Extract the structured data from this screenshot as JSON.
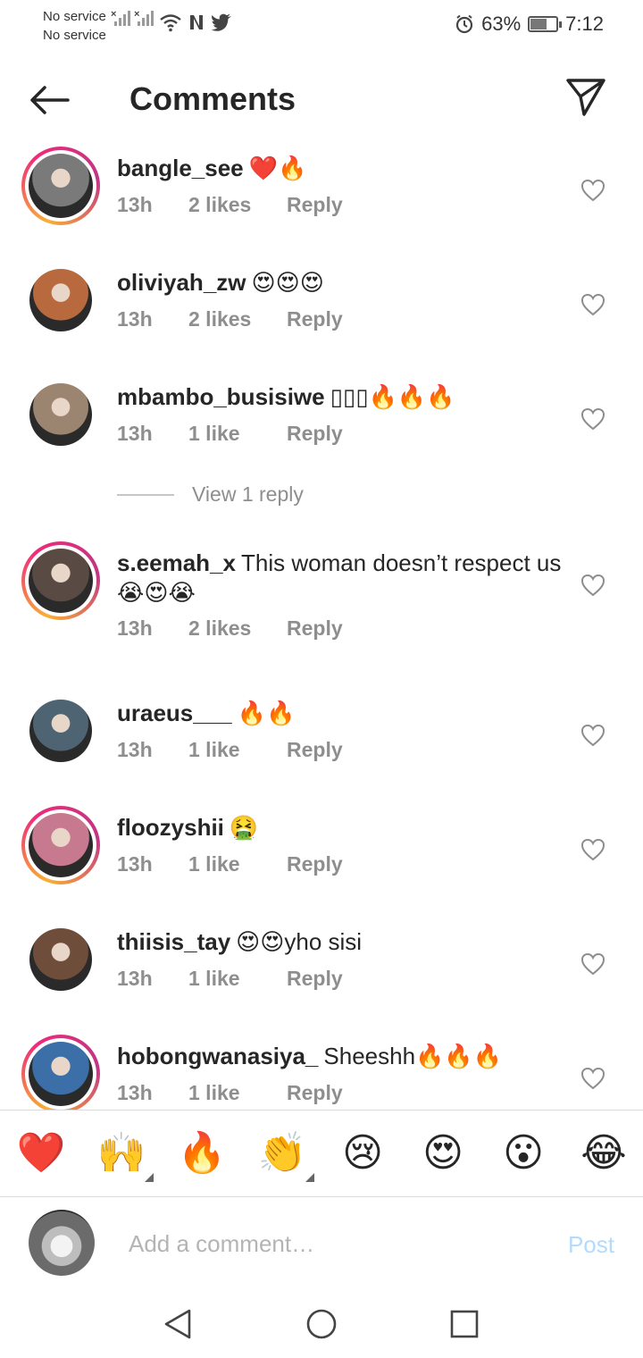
{
  "status_bar": {
    "carrier_1": "No service",
    "carrier_2": "No service",
    "battery_text": "63%",
    "battery_level": 0.63,
    "time": "7:12",
    "icons": [
      "signal-x-icon",
      "signal-x-icon",
      "wifi-icon",
      "netflix-icon",
      "twitter-icon",
      "alarm-icon",
      "battery-icon"
    ]
  },
  "header": {
    "title": "Comments",
    "back_icon": "arrow-left-icon",
    "share_icon": "send-icon"
  },
  "comments": [
    {
      "user": "bangle_see",
      "text": "❤️🔥",
      "time": "13h",
      "likes": "2 likes",
      "reply": "Reply",
      "story_ring": true,
      "avatar_color": "#7a7a7a"
    },
    {
      "user": "oliviyah_zw",
      "text": "😍😍😍",
      "time": "13h",
      "likes": "2 likes",
      "reply": "Reply",
      "story_ring": false,
      "avatar_color": "#b86a3e"
    },
    {
      "user": "mbambo_busisiwe",
      "text": "▯▯▯🔥🔥🔥",
      "time": "13h",
      "likes": "1 like",
      "reply": "Reply",
      "story_ring": false,
      "avatar_color": "#9b8570"
    },
    {
      "user": "s.eemah_x",
      "text": "This woman doesn’t respect us😭😍😭",
      "time": "13h",
      "likes": "2 likes",
      "reply": "Reply",
      "story_ring": true,
      "avatar_color": "#5a4a44"
    },
    {
      "user": "uraeus___",
      "text": "🔥🔥",
      "time": "13h",
      "likes": "1 like",
      "reply": "Reply",
      "story_ring": false,
      "avatar_color": "#4f6473"
    },
    {
      "user": "floozyshii",
      "text": "🤮",
      "time": "13h",
      "likes": "1 like",
      "reply": "Reply",
      "story_ring": true,
      "avatar_color": "#c77a8f"
    },
    {
      "user": "thiisis_tay",
      "text": "😍😍yho sisi",
      "time": "13h",
      "likes": "1 like",
      "reply": "Reply",
      "story_ring": false,
      "avatar_color": "#6e4d3a"
    },
    {
      "user": "hobongwanasiya_",
      "text": "Sheeshh🔥🔥🔥",
      "time": "13h",
      "likes": "1 like",
      "reply": "Reply",
      "story_ring": true,
      "avatar_color": "#3c6fa8"
    }
  ],
  "view_replies": "View 1 reply",
  "quick_reactions": [
    "❤️",
    "🙌",
    "🔥",
    "👏",
    "😢",
    "😍",
    "😮",
    "😂"
  ],
  "composer": {
    "placeholder": "Add a comment…",
    "post_label": "Post"
  },
  "nav": [
    "back-triangle-icon",
    "home-circle-icon",
    "recents-square-icon"
  ]
}
